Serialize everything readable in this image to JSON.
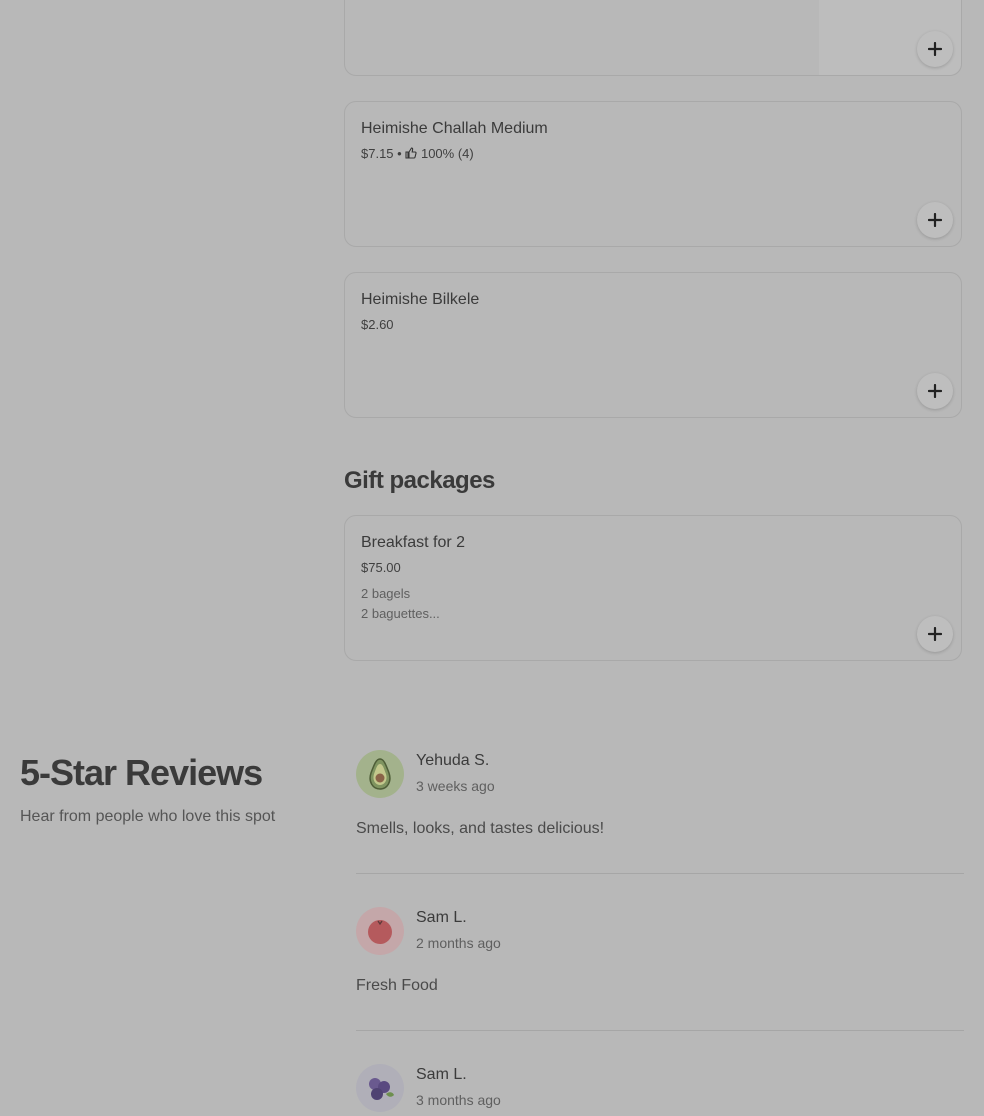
{
  "menu_items": [
    {
      "name": "",
      "price": "",
      "description": []
    },
    {
      "name": "Heimishe Challah Medium",
      "price": "$7.15",
      "rating": "100% (4)",
      "description": []
    },
    {
      "name": "Heimishe Bilkele",
      "price": "$2.60",
      "description": []
    }
  ],
  "gift_section": {
    "title": "Gift packages",
    "items": [
      {
        "name": "Breakfast for 2",
        "price": "$75.00",
        "description": [
          "2 bagels",
          "2 baguettes..."
        ]
      }
    ]
  },
  "reviews": {
    "title": "5-Star Reviews",
    "subtitle": "Hear from people who love this spot",
    "items": [
      {
        "author": "Yehuda S.",
        "time": "3 weeks ago",
        "text": "Smells, looks, and tastes delicious!",
        "avatar": "avocado-icon"
      },
      {
        "author": "Sam L.",
        "time": "2 months ago",
        "text": "Fresh Food",
        "avatar": "tomato-icon"
      },
      {
        "author": "Sam L.",
        "time": "3 months ago",
        "text": "",
        "avatar": "blueberries-icon"
      }
    ]
  },
  "colors": {
    "background": "#b8b8b8",
    "text": "#3a3a3a",
    "muted": "#5f5f5f"
  }
}
